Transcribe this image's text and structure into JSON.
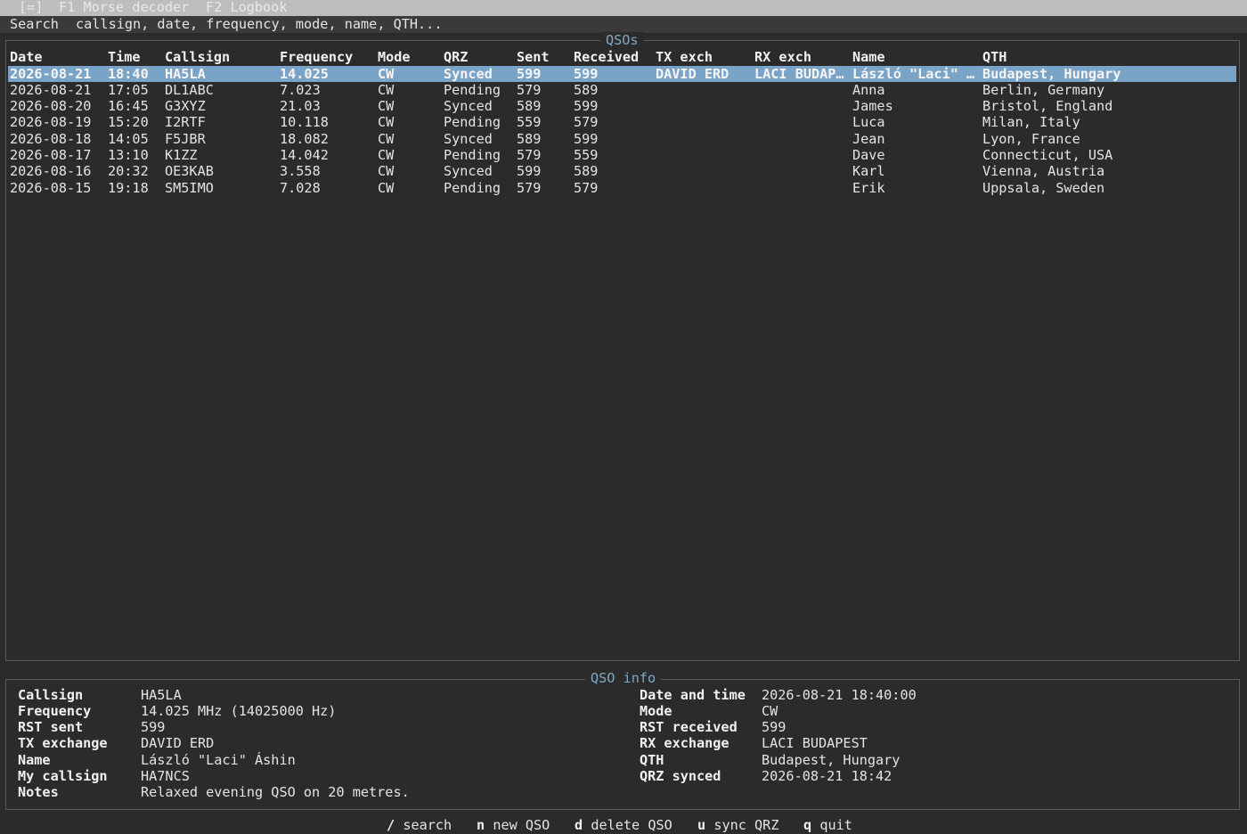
{
  "menubar": {
    "menu_icon": "[=]",
    "tabs": [
      {
        "key": "F1",
        "label": "Morse decoder"
      },
      {
        "key": "F2",
        "label": "Logbook"
      }
    ]
  },
  "search": {
    "label": "Search",
    "placeholder": "callsign, date, frequency, mode, name, QTH..."
  },
  "qso_panel": {
    "title": "QSOs",
    "columns": [
      "Date",
      "Time",
      "Callsign",
      "Frequency",
      "Mode",
      "QRZ",
      "Sent",
      "Received",
      "TX exch",
      "RX exch",
      "Name",
      "QTH"
    ],
    "rows": [
      [
        "2026-08-21",
        "18:40",
        "HA5LA",
        "14.025",
        "CW",
        "Synced",
        "599",
        "599",
        "DAVID ERD",
        "LACI BUDAP…",
        "László \"Laci\" …",
        "Budapest, Hungary"
      ],
      [
        "2026-08-21",
        "17:05",
        "DL1ABC",
        "7.023",
        "CW",
        "Pending",
        "579",
        "589",
        "",
        "",
        "Anna",
        "Berlin, Germany"
      ],
      [
        "2026-08-20",
        "16:45",
        "G3XYZ",
        "21.03",
        "CW",
        "Synced",
        "589",
        "599",
        "",
        "",
        "James",
        "Bristol, England"
      ],
      [
        "2026-08-19",
        "15:20",
        "I2RTF",
        "10.118",
        "CW",
        "Pending",
        "559",
        "579",
        "",
        "",
        "Luca",
        "Milan, Italy"
      ],
      [
        "2026-08-18",
        "14:05",
        "F5JBR",
        "18.082",
        "CW",
        "Synced",
        "589",
        "599",
        "",
        "",
        "Jean",
        "Lyon, France"
      ],
      [
        "2026-08-17",
        "13:10",
        "K1ZZ",
        "14.042",
        "CW",
        "Pending",
        "579",
        "559",
        "",
        "",
        "Dave",
        "Connecticut, USA"
      ],
      [
        "2026-08-16",
        "20:32",
        "OE3KAB",
        "3.558",
        "CW",
        "Synced",
        "599",
        "589",
        "",
        "",
        "Karl",
        "Vienna, Austria"
      ],
      [
        "2026-08-15",
        "19:18",
        "SM5IMO",
        "7.028",
        "CW",
        "Pending",
        "579",
        "579",
        "",
        "",
        "Erik",
        "Uppsala, Sweden"
      ]
    ],
    "selected_row": 0
  },
  "info_panel": {
    "title": "QSO info",
    "left": [
      {
        "label": "Callsign",
        "value": "HA5LA"
      },
      {
        "label": "Frequency",
        "value": "14.025 MHz (14025000 Hz)"
      },
      {
        "label": "RST sent",
        "value": "599"
      },
      {
        "label": "TX exchange",
        "value": "DAVID ERD"
      },
      {
        "label": "Name",
        "value": "László \"Laci\" Áshin"
      },
      {
        "label": "My callsign",
        "value": "HA7NCS"
      },
      {
        "label": "Notes",
        "value": "Relaxed evening QSO on 20 metres."
      }
    ],
    "right": [
      {
        "label": "Date and time",
        "value": "2026-08-21 18:40:00"
      },
      {
        "label": "Mode",
        "value": "CW"
      },
      {
        "label": "RST received",
        "value": "599"
      },
      {
        "label": "RX exchange",
        "value": "LACI BUDAPEST"
      },
      {
        "label": "QTH",
        "value": "Budapest, Hungary"
      },
      {
        "label": "QRZ synced",
        "value": "2026-08-21 18:42"
      }
    ]
  },
  "footer": {
    "shortcuts": [
      {
        "key": "/",
        "label": "search"
      },
      {
        "key": "n",
        "label": "new QSO"
      },
      {
        "key": "d",
        "label": "delete QSO"
      },
      {
        "key": "u",
        "label": "sync QRZ"
      },
      {
        "key": "q",
        "label": "quit"
      }
    ]
  },
  "colors": {
    "background": "#2b2b2b",
    "selected_row": "#7aa3c8",
    "panel_title": "#7fa9c4",
    "menubar": "#bdbdbd"
  }
}
